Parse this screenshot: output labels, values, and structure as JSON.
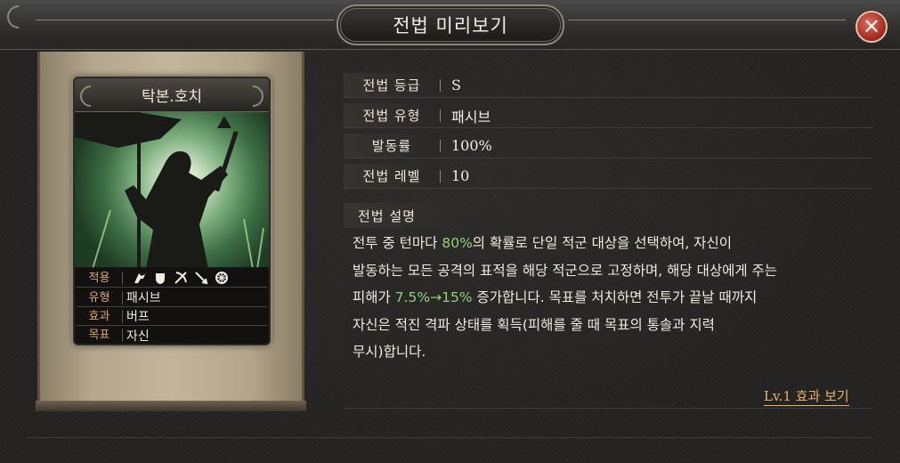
{
  "window": {
    "title": "전법 미리보기",
    "close_icon": "close-icon"
  },
  "card": {
    "name": "탁본.호치",
    "rows": [
      {
        "label": "적용",
        "icons": [
          "cavalry-icon",
          "shield-icon",
          "bow-icon",
          "spear-icon",
          "wheel-icon"
        ]
      },
      {
        "label": "유형",
        "value": "패시브"
      },
      {
        "label": "효과",
        "value": "버프"
      },
      {
        "label": "목표",
        "value": "자신"
      }
    ]
  },
  "stats": [
    {
      "label": "전법 등급",
      "value": "S"
    },
    {
      "label": "전법 유형",
      "value": "패시브"
    },
    {
      "label": "발동률",
      "value": "100%"
    },
    {
      "label": "전법 레벨",
      "value": "10"
    }
  ],
  "description": {
    "heading": "전법 설명",
    "line1_a": "전투 중 턴마다 ",
    "line1_hl": "80%",
    "line1_b": "의 확률로 단일 적군 대상을 선택하여, 자신이",
    "line2": "발동하는 모든 공격의 표적을 해당 적군으로 고정하며, 해당 대상에게 주는",
    "line3_a": "피해가 ",
    "line3_hl": "7.5%→15%",
    "line3_b": " 증가합니다. 목표를 처치하면 전투가 끝날 때까지",
    "line4": "자신은 적진 격파 상태를 획득(피해를 줄 때 목표의 통솔과 지력",
    "line5": "무시)합니다.",
    "highlight_color": "#8fd37b"
  },
  "link": {
    "label": "Lv.1 효과 보기"
  }
}
